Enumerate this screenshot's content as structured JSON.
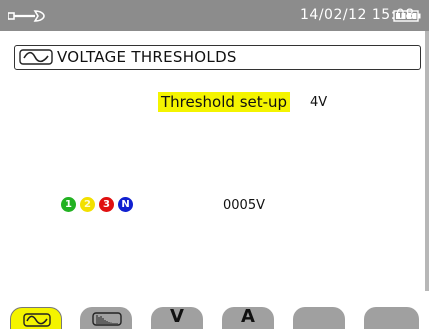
{
  "status_bar": {
    "datetime": "14/02/12 15:08",
    "wrench_icon": "wrench-icon",
    "battery_icon": "battery-icon"
  },
  "header": {
    "icon": "waveform-icon",
    "title": "VOLTAGE THRESHOLDS"
  },
  "threshold": {
    "label": "Threshold set-up",
    "value": "4V"
  },
  "phases": {
    "items": [
      "1",
      "2",
      "3",
      "N"
    ],
    "value": "0005V"
  },
  "tabs": [
    {
      "label": "",
      "icon": "waveform-icon",
      "active": true
    },
    {
      "label": "",
      "icon": "harmonics-icon",
      "active": false
    },
    {
      "label": "V",
      "icon": "",
      "active": false
    },
    {
      "label": "A",
      "icon": "",
      "active": false
    },
    {
      "label": "",
      "icon": "",
      "active": false
    },
    {
      "label": "",
      "icon": "",
      "active": false
    }
  ],
  "colors": {
    "topbar": "#8c8c8c",
    "highlight": "#f4f400",
    "phase1": "#22b222",
    "phase2": "#f2e000",
    "phase3": "#e01010",
    "neutral": "#1020d0",
    "tab_inactive": "#a0a0a0"
  }
}
